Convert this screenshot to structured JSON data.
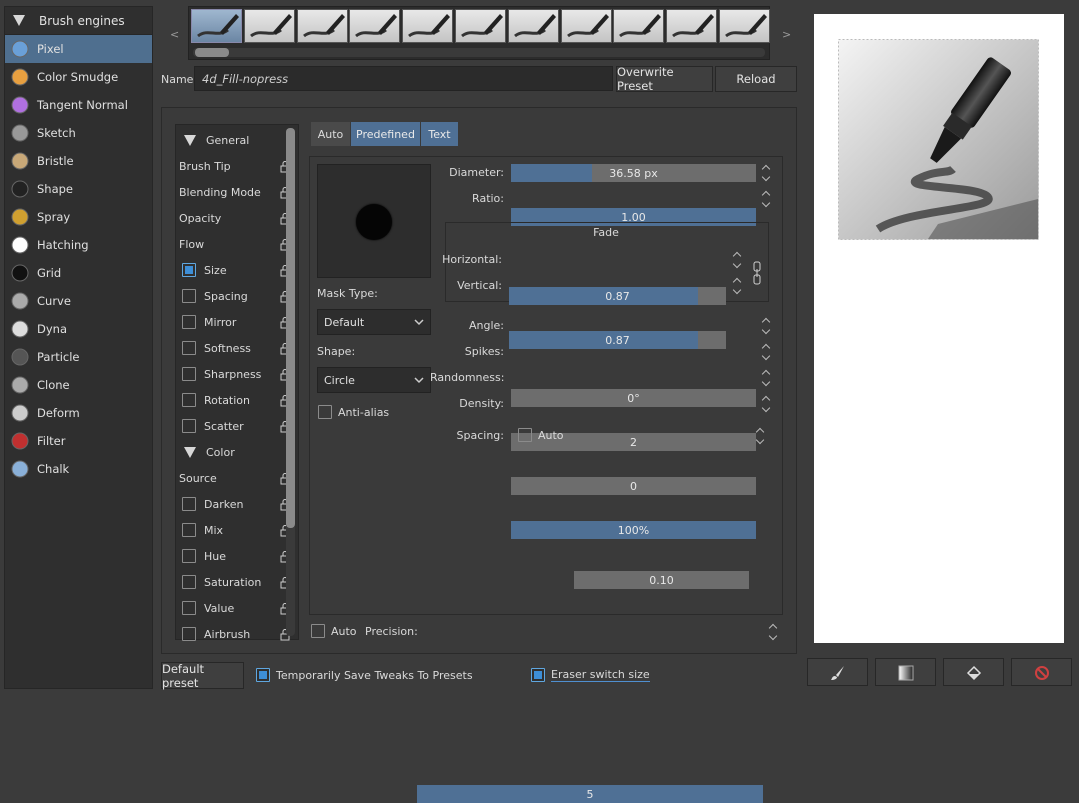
{
  "engines": {
    "header": "Brush engines",
    "items": [
      {
        "label": "Pixel",
        "icon": "pixel-brush-icon",
        "selected": true
      },
      {
        "label": "Color Smudge",
        "icon": "color-smudge-icon"
      },
      {
        "label": "Tangent Normal",
        "icon": "tangent-normal-icon"
      },
      {
        "label": "Sketch",
        "icon": "sketch-icon"
      },
      {
        "label": "Bristle",
        "icon": "bristle-icon"
      },
      {
        "label": "Shape",
        "icon": "shape-icon"
      },
      {
        "label": "Spray",
        "icon": "spray-icon"
      },
      {
        "label": "Hatching",
        "icon": "hatching-icon"
      },
      {
        "label": "Grid",
        "icon": "grid-icon"
      },
      {
        "label": "Curve",
        "icon": "curve-icon"
      },
      {
        "label": "Dyna",
        "icon": "dyna-icon"
      },
      {
        "label": "Particle",
        "icon": "particle-icon"
      },
      {
        "label": "Clone",
        "icon": "clone-icon"
      },
      {
        "label": "Deform",
        "icon": "deform-icon"
      },
      {
        "label": "Filter",
        "icon": "filter-icon"
      },
      {
        "label": "Chalk",
        "icon": "chalk-icon"
      }
    ]
  },
  "strip": {
    "prev": "<",
    "next": ">",
    "thumb_count": 11,
    "selected_index": 0
  },
  "name": {
    "label": "Name:",
    "value": "4d_Fill-nopress",
    "overwrite": "Overwrite Preset",
    "reload": "Reload"
  },
  "options": {
    "general_header": "General",
    "general": [
      {
        "label": "Brush Tip",
        "checkbox": false
      },
      {
        "label": "Blending Mode",
        "checkbox": false
      },
      {
        "label": "Opacity",
        "checkbox": false
      },
      {
        "label": "Flow",
        "checkbox": false
      },
      {
        "label": "Size",
        "checkbox": true,
        "checked": true
      },
      {
        "label": "Spacing",
        "checkbox": true,
        "checked": false
      },
      {
        "label": "Mirror",
        "checkbox": true,
        "checked": false
      },
      {
        "label": "Softness",
        "checkbox": true,
        "checked": false
      },
      {
        "label": "Sharpness",
        "checkbox": true,
        "checked": false
      },
      {
        "label": "Rotation",
        "checkbox": true,
        "checked": false
      },
      {
        "label": "Scatter",
        "checkbox": true,
        "checked": false
      }
    ],
    "color_header": "Color",
    "color": [
      {
        "label": "Source",
        "checkbox": false
      },
      {
        "label": "Darken",
        "checkbox": true,
        "checked": false
      },
      {
        "label": "Mix",
        "checkbox": true,
        "checked": false
      },
      {
        "label": "Hue",
        "checkbox": true,
        "checked": false
      },
      {
        "label": "Saturation",
        "checkbox": true,
        "checked": false
      },
      {
        "label": "Value",
        "checkbox": true,
        "checked": false
      },
      {
        "label": "Airbrush",
        "checkbox": true,
        "checked": false
      }
    ]
  },
  "tabs": {
    "auto": "Auto",
    "predefined": "Predefined",
    "text": "Text"
  },
  "tip": {
    "mask_type_label": "Mask Type:",
    "mask_type_value": "Default",
    "shape_label": "Shape:",
    "shape_value": "Circle",
    "antialias": "Anti-alias",
    "diameter": {
      "label": "Diameter:",
      "value": "36.58 px",
      "fill": 0.33
    },
    "ratio": {
      "label": "Ratio:",
      "value": "1.00",
      "fill": 1.0
    },
    "fade": {
      "title": "Fade",
      "horizontal": {
        "label": "Horizontal:",
        "value": "0.87",
        "fill": 0.87
      },
      "vertical": {
        "label": "Vertical:",
        "value": "0.87",
        "fill": 0.87
      }
    },
    "angle": {
      "label": "Angle:",
      "value": "0°",
      "fill": 0
    },
    "spikes": {
      "label": "Spikes:",
      "value": "2",
      "fill": 0
    },
    "randomness": {
      "label": "Randomness:",
      "value": "0",
      "fill": 0
    },
    "density": {
      "label": "Density:",
      "value": "100%",
      "fill": 1.0
    },
    "spacing": {
      "label": "Spacing:",
      "auto": "Auto",
      "value": "0.10",
      "fill": 0
    }
  },
  "precision": {
    "auto": "Auto",
    "label": "Precision:",
    "value": "5",
    "fill": 1.0
  },
  "bottom": {
    "default_preset": "Default preset",
    "save_tweaks": "Temporarily Save Tweaks To Presets",
    "eraser": "Eraser switch size"
  },
  "colors": {
    "accent": "#4f7095",
    "selection": "#4f6f8f",
    "check": "#3d8ed6"
  }
}
